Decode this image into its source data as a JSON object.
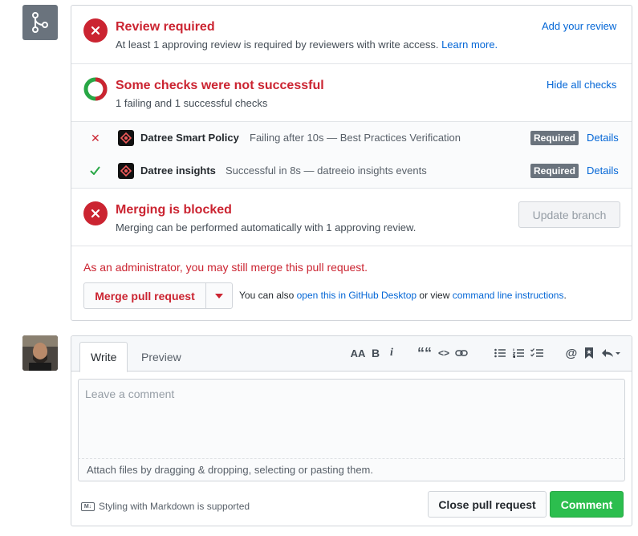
{
  "colors": {
    "danger": "#cb2431",
    "success": "#28a745",
    "link": "#0366d6",
    "muted": "#6a737d"
  },
  "review": {
    "title": "Review required",
    "desc": "At least 1 approving review is required by reviewers with write access.",
    "learn_more": "Learn more.",
    "add_review": "Add your review"
  },
  "checks": {
    "title": "Some checks were not successful",
    "desc": "1 failing and 1 successful checks",
    "hide_all": "Hide all checks",
    "items": [
      {
        "status": "failure",
        "status_icon": "x-icon",
        "name": "Datree Smart Policy",
        "desc": "Failing after 10s — Best Practices Verification",
        "badge": "Required",
        "details": "Details"
      },
      {
        "status": "success",
        "status_icon": "check-icon",
        "name": "Datree insights",
        "desc": "Successful in 8s — datreeio insights events",
        "badge": "Required",
        "details": "Details"
      }
    ]
  },
  "merge_blocked": {
    "title": "Merging is blocked",
    "desc": "Merging can be performed automatically with 1 approving review.",
    "update_branch": "Update branch"
  },
  "admin": {
    "note": "As an administrator, you may still merge this pull request.",
    "merge_button": "Merge pull request",
    "also_prefix": "You can also",
    "desktop_link": "open this in GitHub Desktop",
    "or_view": "or view",
    "cli_link": "command line instructions",
    "period": "."
  },
  "comment": {
    "tabs": [
      "Write",
      "Preview"
    ],
    "toolbar": {
      "header": "AA",
      "bold": "B",
      "italic": "i",
      "quote": "““",
      "code": "<>",
      "mention": "@"
    },
    "placeholder": "Leave a comment",
    "attach": "Attach files by dragging & dropping, selecting or pasting them.",
    "markdown_note": "Styling with Markdown is supported",
    "markdown_badge": "M↓",
    "close_button": "Close pull request",
    "comment_button": "Comment"
  }
}
